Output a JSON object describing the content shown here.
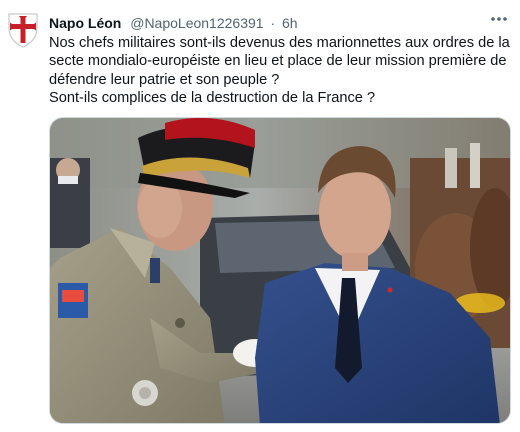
{
  "tweet": {
    "author_name": "Napo Léon",
    "author_handle": "@NapoLeon1226391",
    "separator": "·",
    "timestamp": "6h",
    "more_icon": "more-horizontal-icon",
    "avatar_icon": "templar-cross-shield-icon",
    "text_lines": [
      "Nos chefs militaires sont-ils devenus des marionnettes aux ordres de la",
      "secte mondialo-européiste en lieu et place de leur mission première de",
      "défendre leur patrie et son peuple ?",
      "Sont-ils complices de la destruction de la France ?"
    ],
    "media": {
      "type": "photo",
      "icon": "photo-of-general-and-president-icon"
    }
  },
  "colors": {
    "text": "#0f1419",
    "secondary": "#536471",
    "border": "#cfd9de",
    "cross_red": "#c8202a"
  }
}
